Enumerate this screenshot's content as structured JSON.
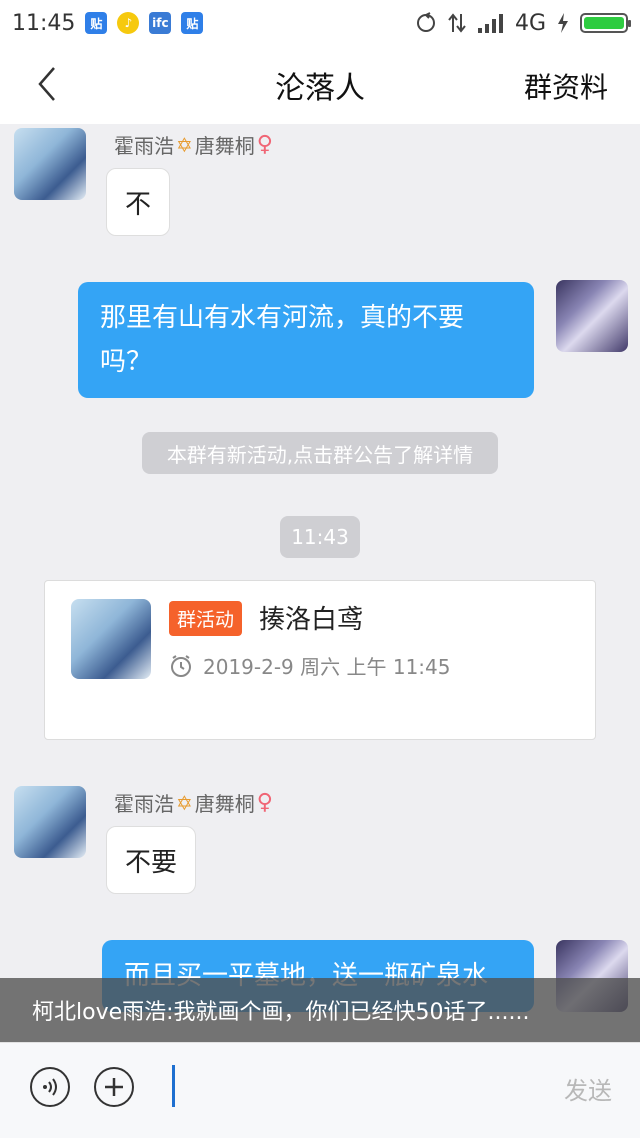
{
  "status_bar": {
    "time": "11:45",
    "network": "4G",
    "app_icons": [
      "tieba-icon",
      "music-icon",
      "news-icon",
      "tieba-icon"
    ]
  },
  "nav": {
    "title": "沦落人",
    "right_label": "群资料"
  },
  "messages": [
    {
      "sender": "霍雨浩",
      "sender2": "唐舞桐",
      "text": "不"
    },
    {
      "text_line1": "那里有山有水有河流，真的不要",
      "text_line2": "吗？"
    },
    {
      "sender": "霍雨浩",
      "sender2": "唐舞桐",
      "text": "不要"
    },
    {
      "text": "而且买一平墓地，送一瓶矿泉水"
    }
  ],
  "system_tip": "本群有新活动,点击群公告了解详情",
  "time_divider": "11:43",
  "event_card": {
    "badge": "群活动",
    "title": "揍洛白鸢",
    "time": "2019-2-9 周六 上午 11:45"
  },
  "banner": "柯北love雨浩:我就画个画，你们已经快50话了......",
  "input": {
    "send_label": "发送",
    "placeholder": ""
  },
  "colors": {
    "accent_blue": "#34a4f5",
    "badge_orange": "#f5622b",
    "gender_pink": "#f06575",
    "star_gold": "#e79b2f"
  }
}
